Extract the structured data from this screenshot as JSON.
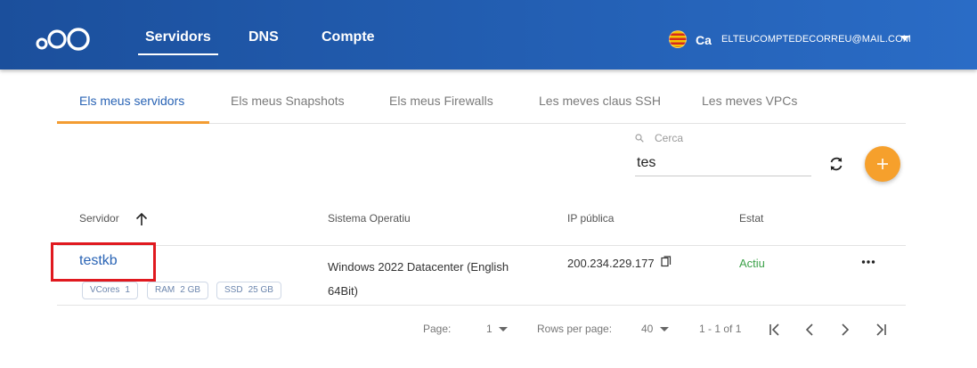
{
  "header": {
    "nav": [
      {
        "label": "Servidors",
        "active": true
      },
      {
        "label": "DNS",
        "active": false
      },
      {
        "label": "Compte",
        "active": false
      }
    ],
    "lang_code": "Ca",
    "account_email": "ELTEUCOMPTEDECORREU@MAIL.COM",
    "colors": {
      "bar_start": "#1b4f9c",
      "bar_end": "#2a6cc6"
    }
  },
  "tabs": [
    {
      "label": "Els meus servidors",
      "active": true
    },
    {
      "label": "Els meus Snapshots",
      "active": false
    },
    {
      "label": "Els meus Firewalls",
      "active": false
    },
    {
      "label": "Les meves claus SSH",
      "active": false
    },
    {
      "label": "Les meves VPCs",
      "active": false
    }
  ],
  "search": {
    "label": "Cerca",
    "value": "tes"
  },
  "table": {
    "columns": [
      "Servidor",
      "Sistema Operatiu",
      "IP pública",
      "Estat"
    ],
    "sort_icon": "arrow-up-icon",
    "rows": [
      {
        "name": "testkb",
        "os": "Windows 2022 Datacenter (English 64Bit)",
        "ip": "200.234.229.177",
        "status": "Actiu",
        "specs": [
          {
            "label": "VCores",
            "value": "1"
          },
          {
            "label": "RAM",
            "value": "2 GB"
          },
          {
            "label": "SSD",
            "value": "25 GB"
          }
        ]
      }
    ]
  },
  "pagination": {
    "page_label": "Page:",
    "page_value": "1",
    "rows_label": "Rows per page:",
    "rows_value": "40",
    "range": "1 - 1 of 1"
  },
  "colors": {
    "accent": "#f6a02c",
    "link": "#2a64b5",
    "status_ok": "#3da24a",
    "highlight": "#e0191f"
  }
}
